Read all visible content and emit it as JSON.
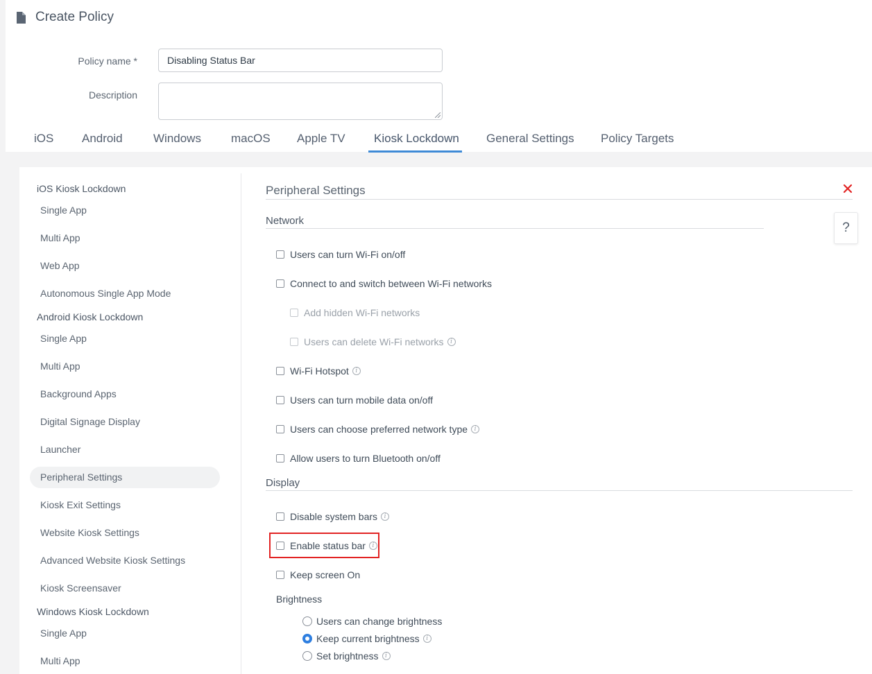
{
  "header": {
    "title": "Create Policy",
    "icon": "document-icon"
  },
  "form": {
    "policy_name_label": "Policy name *",
    "policy_name_value": "Disabling Status Bar",
    "description_label": "Description",
    "description_value": ""
  },
  "tabs": {
    "items": [
      "iOS",
      "Android",
      "Windows",
      "macOS",
      "Apple TV",
      "Kiosk Lockdown",
      "General Settings",
      "Policy Targets"
    ],
    "active": "Kiosk Lockdown"
  },
  "sidebar": {
    "ios": {
      "head": "iOS Kiosk Lockdown",
      "items": [
        "Single App",
        "Multi App",
        "Web App",
        "Autonomous Single App Mode"
      ]
    },
    "android": {
      "head": "Android Kiosk Lockdown",
      "items": [
        "Single App",
        "Multi App",
        "Background Apps",
        "Digital Signage Display",
        "Launcher",
        "Peripheral Settings",
        "Kiosk Exit Settings",
        "Website Kiosk Settings",
        "Advanced Website Kiosk Settings",
        "Kiosk Screensaver"
      ]
    },
    "windows": {
      "head": "Windows Kiosk Lockdown",
      "items": [
        "Single App",
        "Multi App"
      ]
    },
    "active": "Peripheral Settings"
  },
  "content": {
    "section_title": "Peripheral Settings",
    "help_label": "?",
    "network": {
      "title": "Network",
      "options": [
        {
          "label": "Users can turn Wi-Fi on/off",
          "checked": false,
          "disabled": false,
          "info": false
        },
        {
          "label": "Connect to and switch between Wi-Fi networks",
          "checked": false,
          "disabled": false,
          "info": false
        },
        {
          "label": "Add hidden Wi-Fi networks",
          "checked": false,
          "disabled": true,
          "info": false
        },
        {
          "label": "Users can delete Wi-Fi networks",
          "checked": false,
          "disabled": true,
          "info": true
        },
        {
          "label": "Wi-Fi Hotspot",
          "checked": false,
          "disabled": false,
          "info": true
        },
        {
          "label": "Users can turn mobile data on/off",
          "checked": false,
          "disabled": false,
          "info": false
        },
        {
          "label": "Users can choose preferred network type",
          "checked": false,
          "disabled": false,
          "info": true
        },
        {
          "label": "Allow users to turn Bluetooth on/off",
          "checked": false,
          "disabled": false,
          "info": false
        }
      ]
    },
    "display": {
      "title": "Display",
      "options": [
        {
          "label": "Disable system bars",
          "checked": false,
          "info": true
        },
        {
          "label": "Enable status bar",
          "checked": false,
          "info": true,
          "highlighted": true
        },
        {
          "label": "Keep screen On",
          "checked": false,
          "info": false
        }
      ],
      "brightness": {
        "title": "Brightness",
        "options": [
          {
            "label": "Users can change brightness",
            "selected": false,
            "info": false
          },
          {
            "label": "Keep current brightness",
            "selected": true,
            "info": true
          },
          {
            "label": "Set brightness",
            "selected": false,
            "info": true
          }
        ]
      }
    }
  },
  "colors": {
    "accent": "#3e8ad6",
    "radio_selected": "#2f7fe0",
    "close": "#e22323",
    "highlight": "#e22323"
  }
}
